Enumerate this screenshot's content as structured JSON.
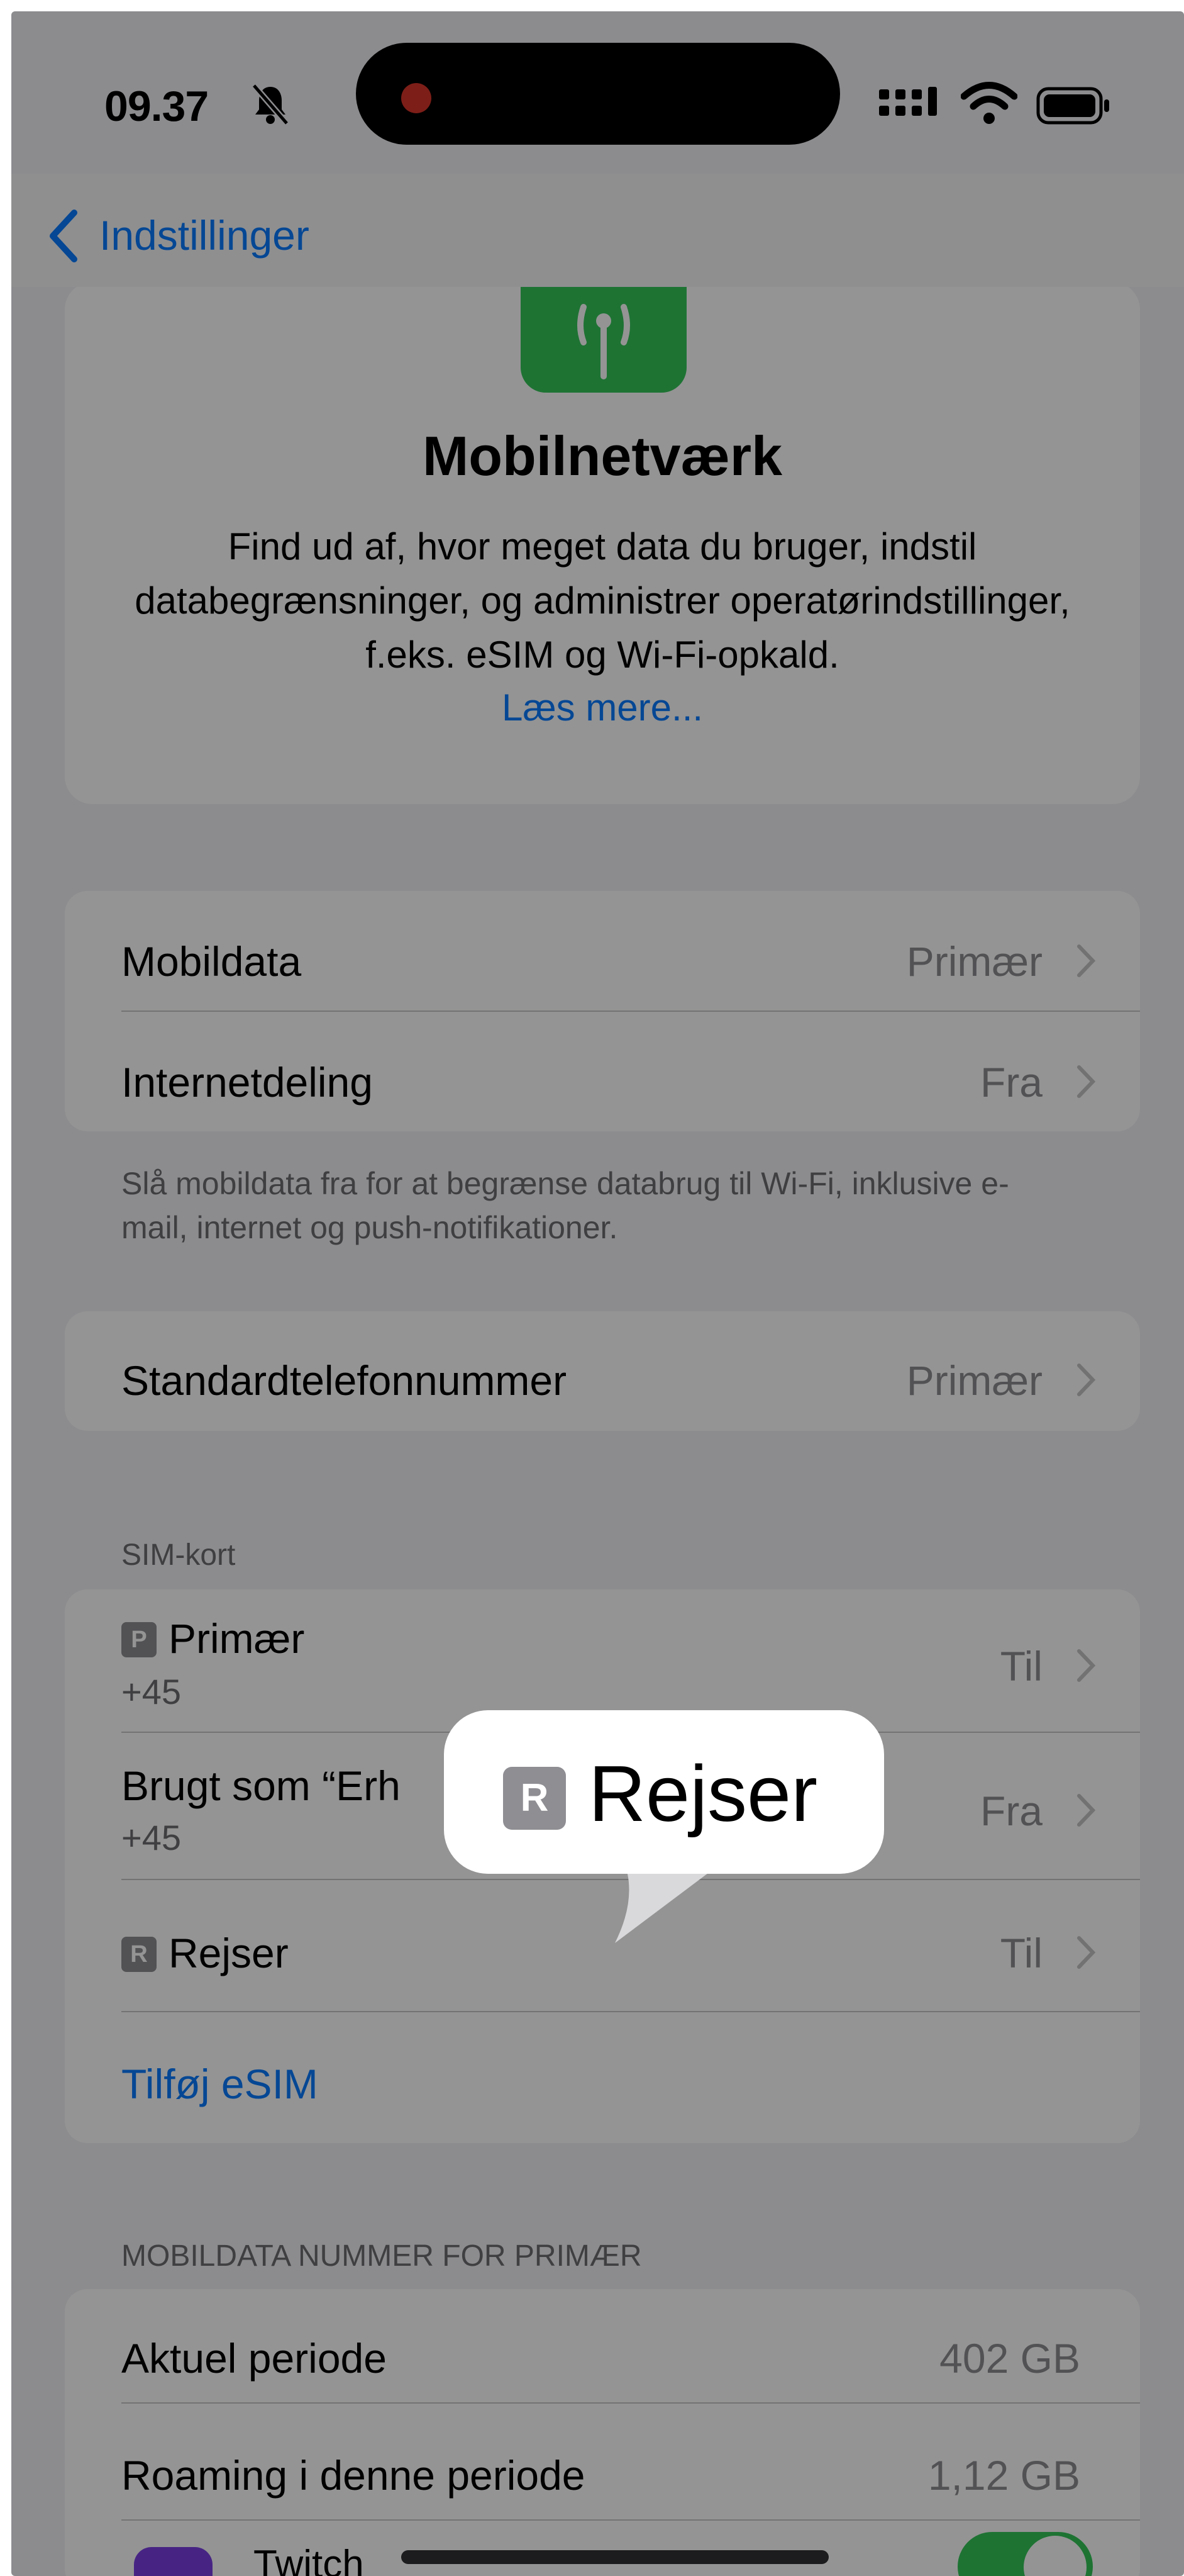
{
  "status_bar": {
    "time": "09.37"
  },
  "nav": {
    "back_label": "Indstillinger"
  },
  "hero": {
    "title": "Mobilnetværk",
    "description": "Find ud af, hvor meget data du bruger, indstil databegrænsninger, og administrer operatørindstillinger, f.eks. eSIM og Wi-Fi-opkald.",
    "link": "Læs mere..."
  },
  "group1": {
    "rows": [
      {
        "label": "Mobildata",
        "value": "Primær"
      },
      {
        "label": "Internetdeling",
        "value": "Fra"
      }
    ],
    "footnote": "Slå mobildata fra for at begrænse databrug til Wi-Fi, inklusive e-mail, internet og push-notifikationer."
  },
  "group2": {
    "label": "Standardtelefonnummer",
    "value": "Primær"
  },
  "sim": {
    "header": "SIM-kort",
    "rows": [
      {
        "badge": "P",
        "label": "Primær",
        "sub": "+45",
        "value": "Til"
      },
      {
        "label": "Brugt som “Erh",
        "sub": "+45",
        "value": "Fra"
      },
      {
        "badge": "R",
        "label": "Rejser",
        "value": "Til"
      }
    ],
    "add_esim": "Tilføj eSIM"
  },
  "usage": {
    "header": "MOBILDATA NUMMER FOR PRIMÆR",
    "rows": [
      {
        "label": "Aktuel periode",
        "value": "402 GB"
      },
      {
        "label": "Roaming i denne periode",
        "value": "1,12 GB"
      }
    ],
    "partial_app": "Twitch"
  },
  "tooltip": {
    "badge": "R",
    "label": "Rejser"
  },
  "colors": {
    "accent": "#0a7aff",
    "green": "#34c759"
  }
}
